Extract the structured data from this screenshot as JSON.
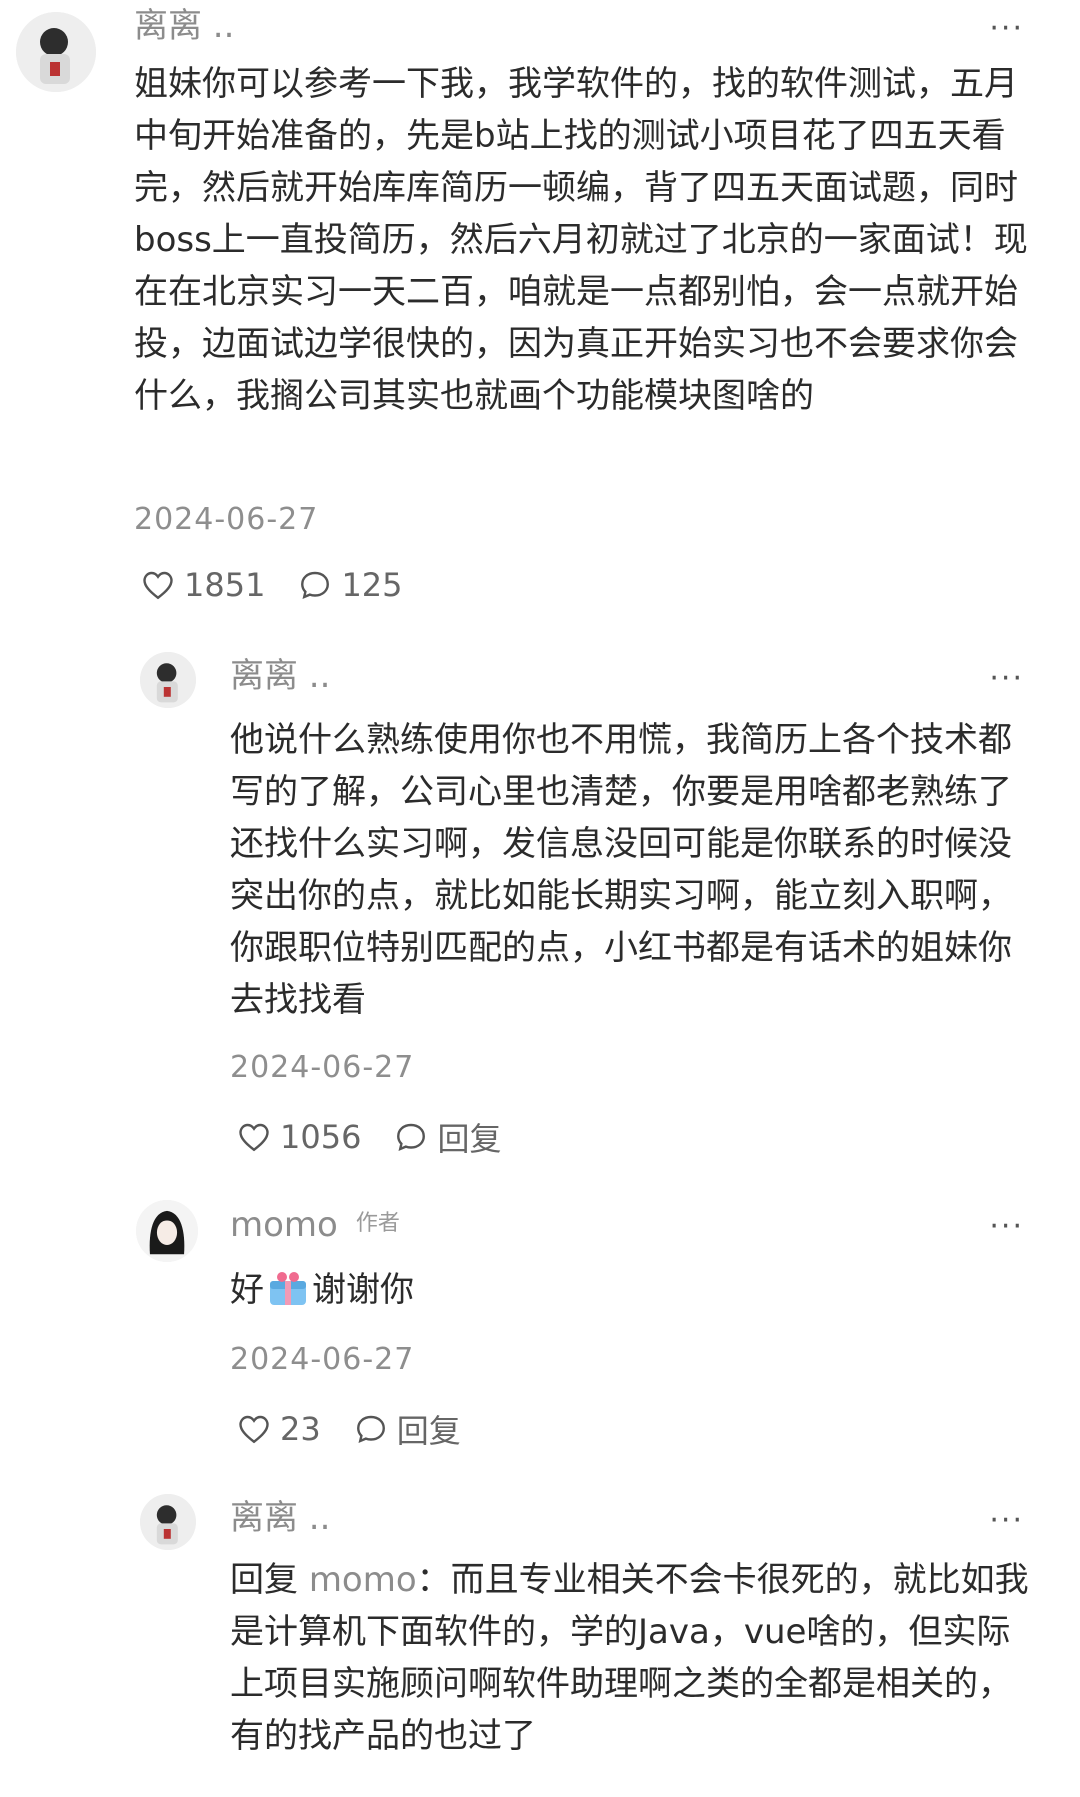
{
  "comments": [
    {
      "author": "离离 ..",
      "text": "姐妹你可以参考一下我，我学软件的，找的软件测试，五月中旬开始准备的，先是b站上找的测试小项目花了四五天看完，然后就开始库库简历一顿编，背了四五天面试题，同时boss上一直投简历，然后六月初就过了北京的一家面试！现在在北京实习一天二百，咱就是一点都别怕，会一点就开始投，边面试边学很快的，因为真正开始实习也不会要求你会什么，我搁公司其实也就画个功能模块图啥的",
      "date": "2024-06-27",
      "likes": "1851",
      "replies": "125"
    },
    {
      "author": "离离 ..",
      "text": "他说什么熟练使用你也不用慌，我简历上各个技术都写的了解，公司心里也清楚，你要是用啥都老熟练了还找什么实习啊，发信息没回可能是你联系的时候没突出你的点，就比如能长期实习啊，能立刻入职啊，你跟职位特别匹配的点，小红书都是有话术的姐妹你去找找看",
      "date": "2024-06-27",
      "likes": "1056",
      "reply_label": "回复"
    },
    {
      "author": "momo",
      "badge": "作者",
      "text_before": "好",
      "text_after": "谢谢你",
      "emoji_icon": "gift-emoji-icon",
      "date": "2024-06-27",
      "likes": "23",
      "reply_label": "回复"
    },
    {
      "author": "离离 ..",
      "reply_prefix": "回复 ",
      "reply_target": "momo",
      "text": "：而且专业相关不会卡很死的，就比如我是计算机下面软件的，学的Java，vue啥的，但实际上项目实施顾问啊软件助理啊之类的全都是相关的，有的找产品的也过了"
    }
  ],
  "more_label": "···",
  "icons": {
    "like": "heart-icon",
    "comment": "comment-bubble-icon"
  },
  "colors": {
    "muted": "#8c8c8c",
    "text": "#2b2b2b"
  }
}
